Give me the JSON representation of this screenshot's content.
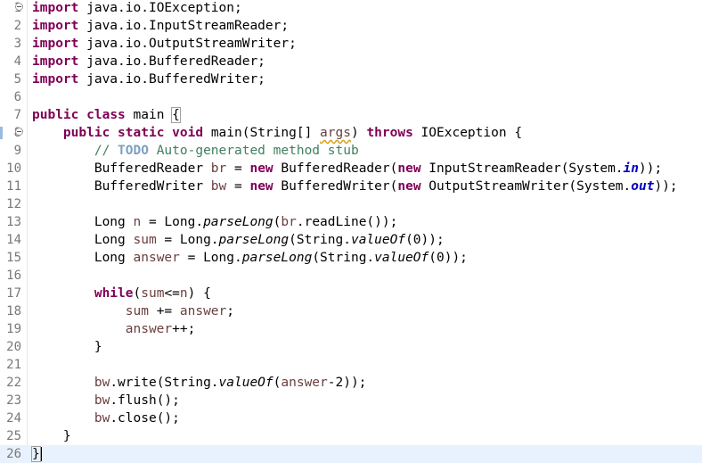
{
  "editor": {
    "current_line": 26,
    "lines": [
      {
        "n": "1",
        "fold": true,
        "tokens": [
          [
            "kw",
            "import"
          ],
          [
            "t",
            " java.io.IOException;"
          ]
        ]
      },
      {
        "n": "2",
        "tokens": [
          [
            "kw",
            "import"
          ],
          [
            "t",
            " java.io.InputStreamReader;"
          ]
        ]
      },
      {
        "n": "3",
        "tokens": [
          [
            "kw",
            "import"
          ],
          [
            "t",
            " java.io.OutputStreamWriter;"
          ]
        ]
      },
      {
        "n": "4",
        "tokens": [
          [
            "kw",
            "import"
          ],
          [
            "t",
            " java.io.BufferedReader;"
          ]
        ]
      },
      {
        "n": "5",
        "tokens": [
          [
            "kw",
            "import"
          ],
          [
            "t",
            " java.io.BufferedWriter;"
          ]
        ]
      },
      {
        "n": "6",
        "tokens": []
      },
      {
        "n": "7",
        "tokens": [
          [
            "kw",
            "public"
          ],
          [
            "t",
            " "
          ],
          [
            "kw",
            "class"
          ],
          [
            "t",
            " main "
          ],
          [
            "box",
            "{"
          ]
        ]
      },
      {
        "n": "8",
        "fold": true,
        "marker": true,
        "tokens": [
          [
            "t",
            "    "
          ],
          [
            "kw",
            "public"
          ],
          [
            "t",
            " "
          ],
          [
            "kw",
            "static"
          ],
          [
            "t",
            " "
          ],
          [
            "kw",
            "void"
          ],
          [
            "t",
            " main(String[] "
          ],
          [
            "var-warn",
            "args"
          ],
          [
            "t",
            ") "
          ],
          [
            "kw",
            "throws"
          ],
          [
            "t",
            " IOException {"
          ]
        ]
      },
      {
        "n": "9",
        "tokens": [
          [
            "t",
            "        "
          ],
          [
            "cm",
            "// "
          ],
          [
            "todo",
            "TODO"
          ],
          [
            "cm",
            " Auto-generated method stub"
          ]
        ]
      },
      {
        "n": "10",
        "tokens": [
          [
            "t",
            "        BufferedReader "
          ],
          [
            "var",
            "br"
          ],
          [
            "t",
            " = "
          ],
          [
            "kw",
            "new"
          ],
          [
            "t",
            " BufferedReader("
          ],
          [
            "kw",
            "new"
          ],
          [
            "t",
            " InputStreamReader(System."
          ],
          [
            "fld",
            "in"
          ],
          [
            "t",
            "));"
          ]
        ]
      },
      {
        "n": "11",
        "tokens": [
          [
            "t",
            "        BufferedWriter "
          ],
          [
            "var",
            "bw"
          ],
          [
            "t",
            " = "
          ],
          [
            "kw",
            "new"
          ],
          [
            "t",
            " BufferedWriter("
          ],
          [
            "kw",
            "new"
          ],
          [
            "t",
            " OutputStreamWriter(System."
          ],
          [
            "fld",
            "out"
          ],
          [
            "t",
            "));"
          ]
        ]
      },
      {
        "n": "12",
        "tokens": []
      },
      {
        "n": "13",
        "tokens": [
          [
            "t",
            "        Long "
          ],
          [
            "var",
            "n"
          ],
          [
            "t",
            " = Long."
          ],
          [
            "st",
            "parseLong"
          ],
          [
            "t",
            "("
          ],
          [
            "var",
            "br"
          ],
          [
            "t",
            ".readLine());"
          ]
        ]
      },
      {
        "n": "14",
        "tokens": [
          [
            "t",
            "        Long "
          ],
          [
            "var",
            "sum"
          ],
          [
            "t",
            " = Long."
          ],
          [
            "st",
            "parseLong"
          ],
          [
            "t",
            "(String."
          ],
          [
            "st",
            "valueOf"
          ],
          [
            "t",
            "(0));"
          ]
        ]
      },
      {
        "n": "15",
        "tokens": [
          [
            "t",
            "        Long "
          ],
          [
            "var",
            "answer"
          ],
          [
            "t",
            " = Long."
          ],
          [
            "st",
            "parseLong"
          ],
          [
            "t",
            "(String."
          ],
          [
            "st",
            "valueOf"
          ],
          [
            "t",
            "(0));"
          ]
        ]
      },
      {
        "n": "16",
        "tokens": []
      },
      {
        "n": "17",
        "tokens": [
          [
            "t",
            "        "
          ],
          [
            "kw",
            "while"
          ],
          [
            "t",
            "("
          ],
          [
            "var",
            "sum"
          ],
          [
            "t",
            "<="
          ],
          [
            "var",
            "n"
          ],
          [
            "t",
            ") {"
          ]
        ]
      },
      {
        "n": "18",
        "tokens": [
          [
            "t",
            "            "
          ],
          [
            "var",
            "sum"
          ],
          [
            "t",
            " += "
          ],
          [
            "var",
            "answer"
          ],
          [
            "t",
            ";"
          ]
        ]
      },
      {
        "n": "19",
        "tokens": [
          [
            "t",
            "            "
          ],
          [
            "var",
            "answer"
          ],
          [
            "t",
            "++;"
          ]
        ]
      },
      {
        "n": "20",
        "tokens": [
          [
            "t",
            "        }"
          ]
        ]
      },
      {
        "n": "21",
        "tokens": []
      },
      {
        "n": "22",
        "tokens": [
          [
            "t",
            "        "
          ],
          [
            "var",
            "bw"
          ],
          [
            "t",
            ".write(String."
          ],
          [
            "st",
            "valueOf"
          ],
          [
            "t",
            "("
          ],
          [
            "var",
            "answer"
          ],
          [
            "t",
            "-2));"
          ]
        ]
      },
      {
        "n": "23",
        "tokens": [
          [
            "t",
            "        "
          ],
          [
            "var",
            "bw"
          ],
          [
            "t",
            ".flush();"
          ]
        ]
      },
      {
        "n": "24",
        "tokens": [
          [
            "t",
            "        "
          ],
          [
            "var",
            "bw"
          ],
          [
            "t",
            ".close();"
          ]
        ]
      },
      {
        "n": "25",
        "tokens": [
          [
            "t",
            "    }"
          ]
        ]
      },
      {
        "n": "26",
        "caret": true,
        "tokens": [
          [
            "box",
            "}"
          ]
        ]
      }
    ]
  },
  "colors": {
    "keyword": "#7f0055",
    "comment": "#3f7f5f",
    "todo": "#7f9fbf",
    "static_field": "#0000c0",
    "local_variable": "#6a3e3e",
    "current_line": "#e8f2fe",
    "line_number": "#787878"
  }
}
